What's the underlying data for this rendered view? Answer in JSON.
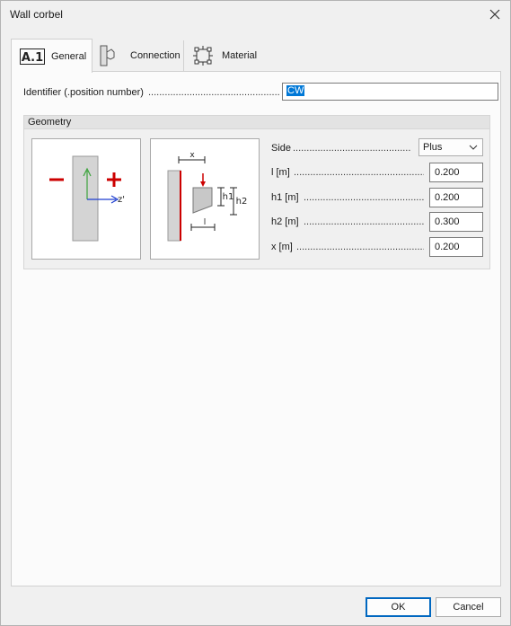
{
  "window": {
    "title": "Wall corbel"
  },
  "tabs": [
    {
      "label": "General",
      "icon": "a1-icon",
      "active": true
    },
    {
      "label": "Connection",
      "icon": "connection-icon",
      "active": false
    },
    {
      "label": "Material",
      "icon": "material-icon",
      "active": false
    }
  ],
  "identifier": {
    "label": "Identifier (.position number)",
    "dots": "...................................................................",
    "value": "CW"
  },
  "geometry": {
    "header": "Geometry",
    "sign_diagram": {
      "minus": "–",
      "plus": "+",
      "axis_label": "z'"
    },
    "dim_diagram": {
      "x": "x",
      "h1": "h1",
      "h2": "h2",
      "l": "l"
    },
    "side": {
      "label": "Side",
      "dots": "..............................................................",
      "value": "Plus"
    },
    "params": [
      {
        "label": "l [m]",
        "dots": "..................................................................................",
        "value": "0.200"
      },
      {
        "label": "h1 [m]",
        "dots": "...............................................................................",
        "value": "0.200"
      },
      {
        "label": "h2 [m]",
        "dots": "...............................................................................",
        "value": "0.300"
      },
      {
        "label": "x [m]",
        "dots": "..................................................................................",
        "value": "0.200"
      }
    ]
  },
  "buttons": {
    "ok": "OK",
    "cancel": "Cancel"
  },
  "colors": {
    "accent": "#0067c0",
    "selection": "#0078d7",
    "red": "#cc0000",
    "green": "#3aa33a",
    "blue": "#1f3fd0"
  }
}
